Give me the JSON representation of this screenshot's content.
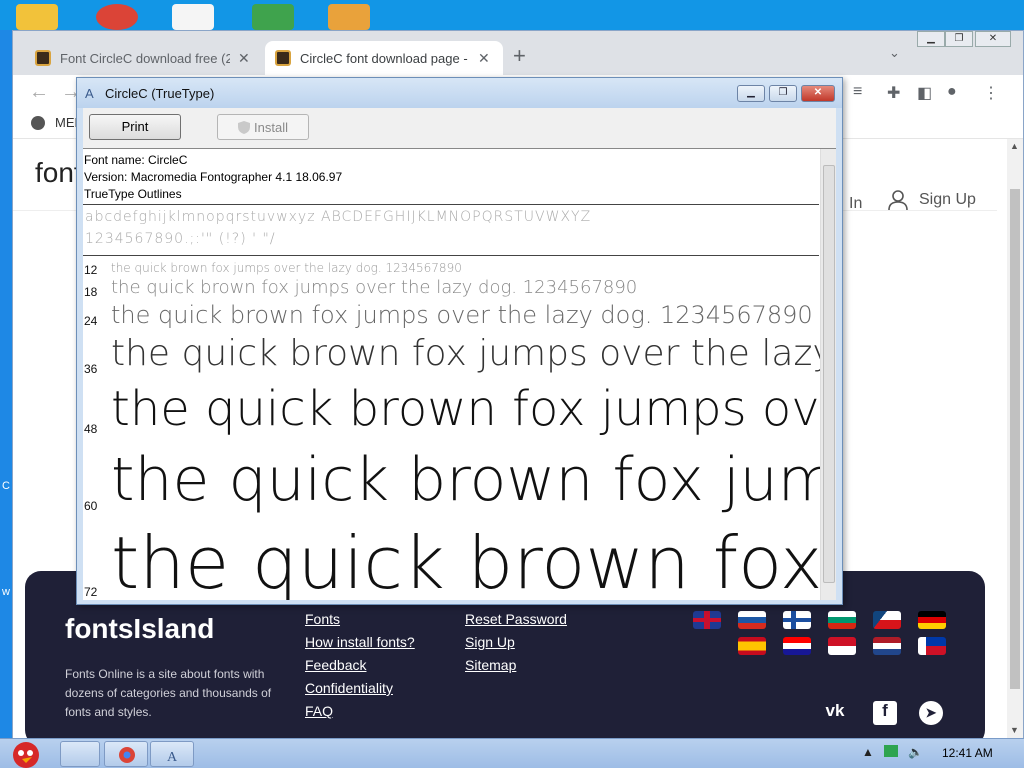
{
  "browser": {
    "tabs": [
      {
        "label": "Font CircleC download free (2",
        "active": false
      },
      {
        "label": "CircleC font download page -",
        "active": true
      }
    ],
    "new_tab": "+",
    "menu_label": "MENU"
  },
  "site": {
    "logo": "fontsIsland",
    "login": "In",
    "signup": "Sign Up"
  },
  "dialog": {
    "title": "CircleC (TrueType)",
    "print": "Print",
    "install": "Install",
    "info": [
      "Font name: CircleC",
      "Version: Macromedia Fontographer 4.1 18.06.97",
      "TrueType Outlines"
    ],
    "charset_line1": "abcdefghijklmnopqrstuvwxyz ABCDEFGHIJKLMNOPQRSTUVWXYZ",
    "charset_line2": "1234567890.;:'\" (!?) ' \"/",
    "sample_text": "the quick brown fox jumps over the lazy dog. 1234567890",
    "sizes": [
      "12",
      "18",
      "24",
      "36",
      "48",
      "60",
      "72"
    ]
  },
  "footer": {
    "brand": "fontsIsland",
    "about": "Fonts Online is a site about fonts with dozens of categories and thousands of fonts and styles.",
    "links_col1": [
      "Fonts",
      "How install fonts?",
      "Feedback",
      "Confidentiality",
      "FAQ"
    ],
    "links_col2": [
      "Reset Password",
      "Sign Up",
      "Sitemap"
    ],
    "social": [
      "vk-icon",
      "facebook-icon",
      "telegram-icon"
    ]
  },
  "taskbar": {
    "time": "12:41 AM"
  },
  "colors": {
    "footer_bg": "#1f2037",
    "desktop": "#1e88e5"
  }
}
